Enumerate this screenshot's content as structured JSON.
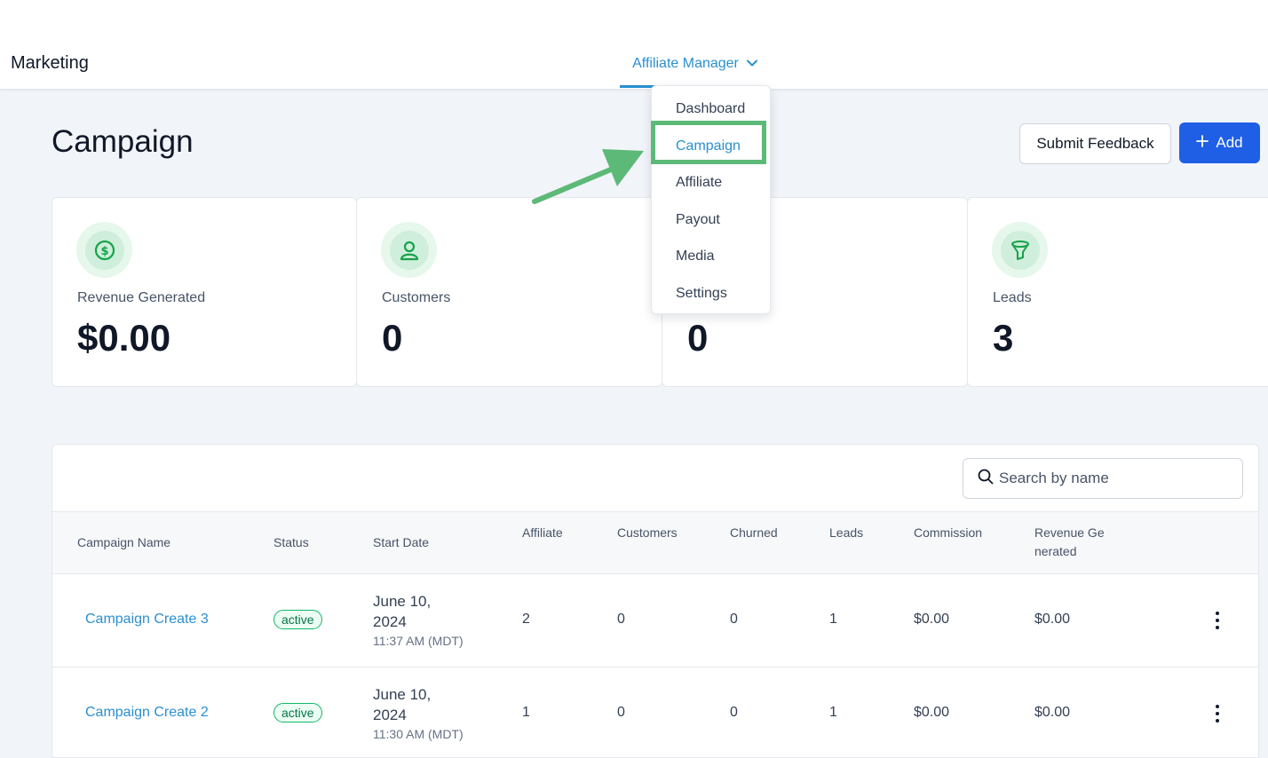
{
  "header": {
    "brand": "Marketing",
    "nav_label": "Affiliate Manager"
  },
  "dropdown": {
    "items": [
      "Dashboard",
      "Campaign",
      "Affiliate",
      "Payout",
      "Media",
      "Settings"
    ],
    "active": "Campaign"
  },
  "page": {
    "title": "Campaign",
    "submit_feedback": "Submit Feedback",
    "add": "Add"
  },
  "stats": [
    {
      "label": "Revenue Generated",
      "value": "$0.00",
      "icon": "dollar-icon"
    },
    {
      "label": "Customers",
      "value": "0",
      "icon": "user-icon"
    },
    {
      "label": "",
      "value": "0",
      "icon": ""
    },
    {
      "label": "Leads",
      "value": "3",
      "icon": "funnel-icon"
    }
  ],
  "search": {
    "placeholder": "Search by name"
  },
  "table": {
    "columns": [
      "Campaign Name",
      "Status",
      "Start Date",
      "Affiliate",
      "Customers",
      "Churned",
      "Leads",
      "Commission",
      "Revenue Generated"
    ],
    "rows": [
      {
        "name": "Campaign Create 3",
        "status": "active",
        "date": "June 10, 2024",
        "time": "11:37 AM (MDT)",
        "affiliate": "2",
        "customers": "0",
        "churned": "0",
        "leads": "1",
        "commission": "$0.00",
        "revenue": "$0.00"
      },
      {
        "name": "Campaign Create 2",
        "status": "active",
        "date": "June 10, 2024",
        "time": "11:30 AM (MDT)",
        "affiliate": "1",
        "customers": "0",
        "churned": "0",
        "leads": "1",
        "commission": "$0.00",
        "revenue": "$0.00"
      }
    ]
  },
  "colors": {
    "accent": "#2a8fd0",
    "primary_button": "#1f5fe6",
    "highlight": "#5cb978",
    "active_badge": "#12b76a"
  }
}
